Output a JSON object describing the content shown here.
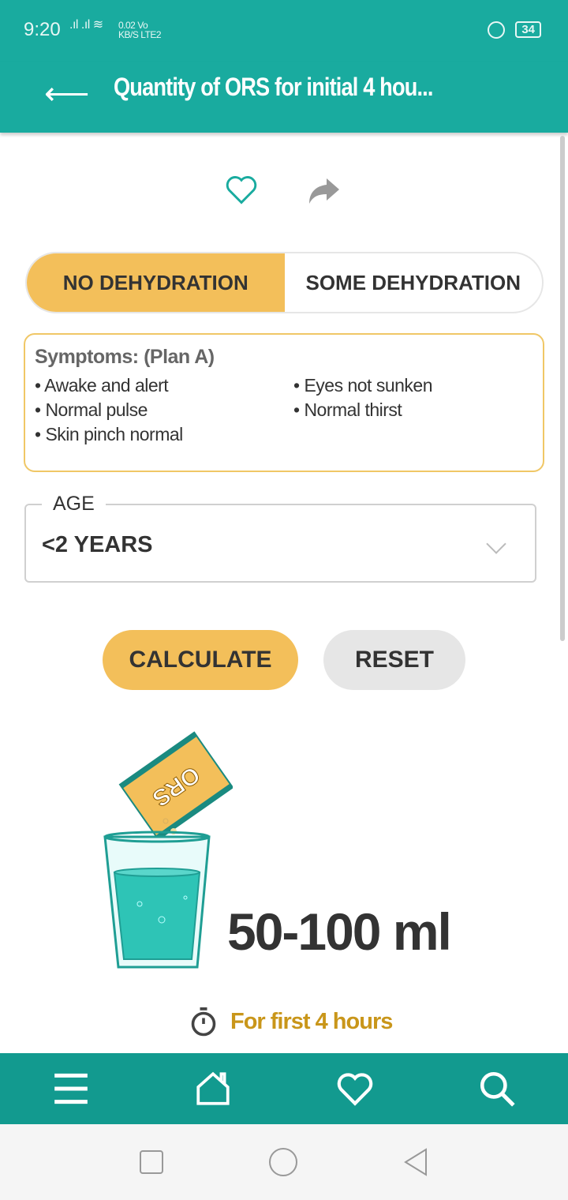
{
  "status": {
    "time": "9:20",
    "net_speed": "0.02",
    "net_unit": "KB/S",
    "volte": "Vo",
    "lte": "LTE2",
    "battery": "34"
  },
  "appbar": {
    "title": "Quantity of ORS for initial 4 hou..."
  },
  "tabs": [
    {
      "label": "NO DEHYDRATION",
      "selected": true
    },
    {
      "label": "SOME DEHYDRATION",
      "selected": false
    }
  ],
  "symptoms": {
    "title": "Symptoms: (Plan A)",
    "items": [
      "• Awake and alert",
      "• Eyes not sunken",
      "• Normal pulse",
      "• Normal thirst",
      "• Skin pinch normal"
    ]
  },
  "age": {
    "label": "AGE",
    "value": "<2 YEARS"
  },
  "buttons": {
    "calculate": "CALCULATE",
    "reset": "RESET"
  },
  "illustration": {
    "packet_text": "ORS"
  },
  "result": {
    "amount": "50-100 ml",
    "duration": "For first 4 hours"
  },
  "colors": {
    "teal": "#19ab9f",
    "accent": "#f3bf5a",
    "duration_text": "#c9961a"
  }
}
